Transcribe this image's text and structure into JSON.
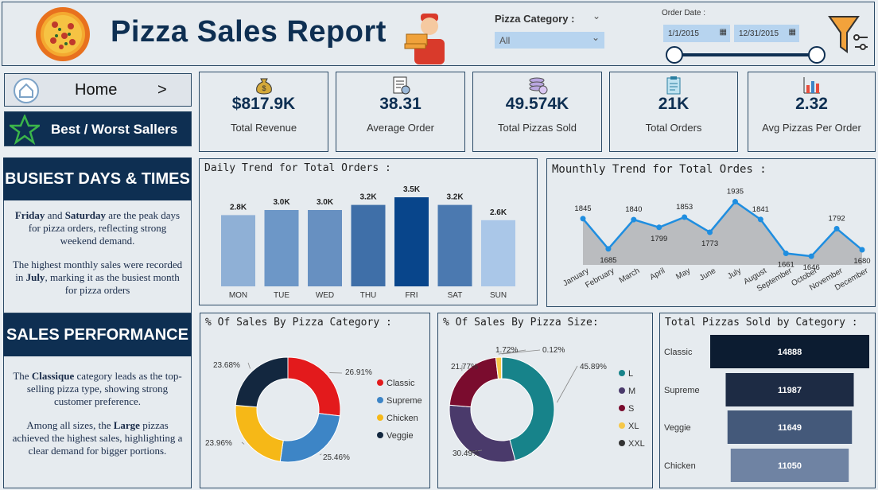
{
  "header": {
    "title": "Pizza Sales Report",
    "category_label": "Pizza Category :",
    "category_value": "All",
    "date_label": "Order Date :",
    "date_start": "1/1/2015",
    "date_end": "12/31/2015"
  },
  "sidebar": {
    "home_label": "Home",
    "home_arrow": ">",
    "best_worst_label": "Best / Worst Sallers",
    "busiest_heading": "BUSIEST DAYS & TIMES",
    "busiest_p1_a": "Friday",
    "busiest_p1_b": " and ",
    "busiest_p1_c": "Saturday",
    "busiest_p1_d": " are the peak days for pizza orders, reflecting strong weekend demand.",
    "busiest_p2_a": "The highest monthly sales were recorded in ",
    "busiest_p2_b": "July",
    "busiest_p2_c": ", marking it as the busiest month for pizza orders",
    "performance_heading": "SALES PERFORMANCE",
    "perf_p1_a": "The ",
    "perf_p1_b": "Classique",
    "perf_p1_c": " category leads as the top-selling pizza type, showing strong customer preference.",
    "perf_p2_a": "Among all sizes, the ",
    "perf_p2_b": "Large",
    "perf_p2_c": " pizzas achieved the highest sales, highlighting a clear demand for bigger portions."
  },
  "kpis": [
    {
      "value": "$817.9K",
      "label": "Total Revenue",
      "icon": "money-bag-icon"
    },
    {
      "value": "38.31",
      "label": "Average Order",
      "icon": "receipt-icon"
    },
    {
      "value": "49.574K",
      "label": "Total Pizzas Sold",
      "icon": "pizza-stack-icon"
    },
    {
      "value": "21K",
      "label": "Total Orders",
      "icon": "clipboard-icon"
    },
    {
      "value": "2.32",
      "label": "Avg Pizzas Per Order",
      "icon": "bar-chart-icon"
    }
  ],
  "colors": {
    "navy": "#0e2f52",
    "line_blue": "#1f8ee0",
    "area_gray": "#b5b7b9",
    "classic": "#e31a1c",
    "supreme": "#3d85c6",
    "chicken": "#f6b817",
    "veggie": "#13273f",
    "size_L": "#17838a",
    "size_M": "#4a3a6b",
    "size_S": "#7a0c2e",
    "size_XL": "#f6c84a",
    "size_XXL": "#333333"
  },
  "chart_data": [
    {
      "type": "bar",
      "title": "Daily Trend for Total Orders :",
      "categories": [
        "MON",
        "TUE",
        "WED",
        "THU",
        "FRI",
        "SAT",
        "SUN"
      ],
      "values": [
        2.8,
        3.0,
        3.0,
        3.2,
        3.5,
        3.2,
        2.6
      ],
      "labels": [
        "2.8K",
        "3.0K",
        "3.0K",
        "3.2K",
        "3.5K",
        "3.2K",
        "2.6K"
      ],
      "colors": [
        "#8fb0d6",
        "#6d97c7",
        "#6790c1",
        "#3f6fa8",
        "#08458b",
        "#4b79b0",
        "#aac7e8"
      ],
      "ylim": [
        0,
        3.5
      ]
    },
    {
      "type": "area",
      "title": "Mounthly Trend for Total Ordes :",
      "categories": [
        "January",
        "February",
        "March",
        "April",
        "May",
        "June",
        "July",
        "August",
        "September",
        "October",
        "November",
        "December"
      ],
      "values": [
        1845,
        1685,
        1840,
        1799,
        1853,
        1773,
        1935,
        1841,
        1661,
        1646,
        1792,
        1680
      ],
      "ylim": [
        1600,
        1950
      ]
    },
    {
      "type": "pie",
      "title": "% Of Sales By Pizza Category :",
      "categories": [
        "Classic",
        "Supreme",
        "Chicken",
        "Veggie"
      ],
      "values": [
        26.91,
        25.46,
        23.96,
        23.68
      ],
      "labels": [
        "26.91%",
        "25.46%",
        "23.96%",
        "23.68%"
      ]
    },
    {
      "type": "pie",
      "title": "% Of Sales By Pizza Size:",
      "categories": [
        "L",
        "M",
        "S",
        "XL",
        "XXL"
      ],
      "values": [
        45.89,
        30.49,
        21.77,
        1.72,
        0.12
      ],
      "labels": [
        "45.89%",
        "30.49%",
        "21.77%",
        "1.72%",
        "0.12%"
      ]
    },
    {
      "type": "bar",
      "title": "Total Pizzas Sold by Category :",
      "categories": [
        "Classic",
        "Supreme",
        "Veggie",
        "Chicken"
      ],
      "values": [
        14888,
        11987,
        11649,
        11050
      ],
      "colors": [
        "#0c1c31",
        "#1d2b44",
        "#44597a",
        "#6f83a3"
      ],
      "xlim": [
        0,
        14888
      ]
    }
  ]
}
